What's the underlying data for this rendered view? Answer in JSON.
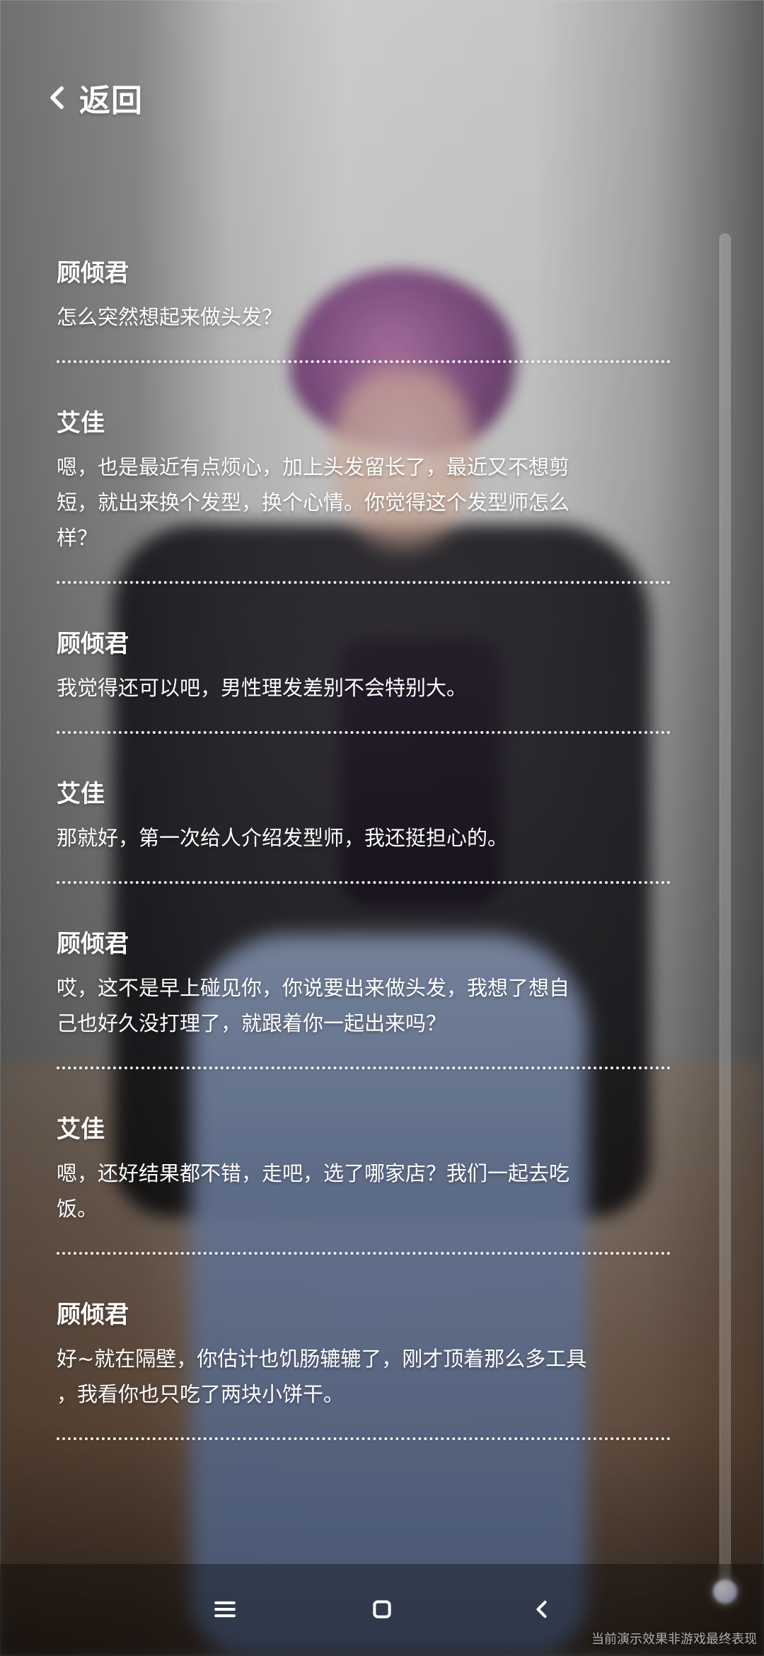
{
  "header": {
    "back_label": "返回",
    "back_icon": "chevron-left-icon"
  },
  "dialog": [
    {
      "speaker": "顾倾君",
      "lines": [
        "怎么突然想起来做头发？"
      ]
    },
    {
      "speaker": "艾佳",
      "lines": [
        "嗯，也是最近有点烦心，加上头发留长了，最近又不想剪",
        "短，就出来换个发型，换个心情。你觉得这个发型师怎么",
        "样？"
      ]
    },
    {
      "speaker": "顾倾君",
      "lines": [
        "我觉得还可以吧，男性理发差别不会特别大。"
      ]
    },
    {
      "speaker": "艾佳",
      "lines": [
        "那就好，第一次给人介绍发型师，我还挺担心的。"
      ]
    },
    {
      "speaker": "顾倾君",
      "lines": [
        "哎，这不是早上碰见你，你说要出来做头发，我想了想自",
        "己也好久没打理了，就跟着你一起出来吗？"
      ]
    },
    {
      "speaker": "艾佳",
      "lines": [
        "嗯，还好结果都不错，走吧，选了哪家店？我们一起去吃",
        "饭。"
      ]
    },
    {
      "speaker": "顾倾君",
      "lines": [
        "好~就在隔壁，你估计也饥肠辘辘了，刚才顶着那么多工具",
        "，我看你也只吃了两块小饼干。"
      ]
    }
  ],
  "navbar": {
    "menu_icon": "menu-icon",
    "home_icon": "home-square-icon",
    "back_icon": "nav-back-icon"
  },
  "watermark": "当前演示效果非游戏最终表现",
  "colors": {
    "text": "#ffffff",
    "navbar_bg": "rgba(0,0,0,0.33)"
  }
}
